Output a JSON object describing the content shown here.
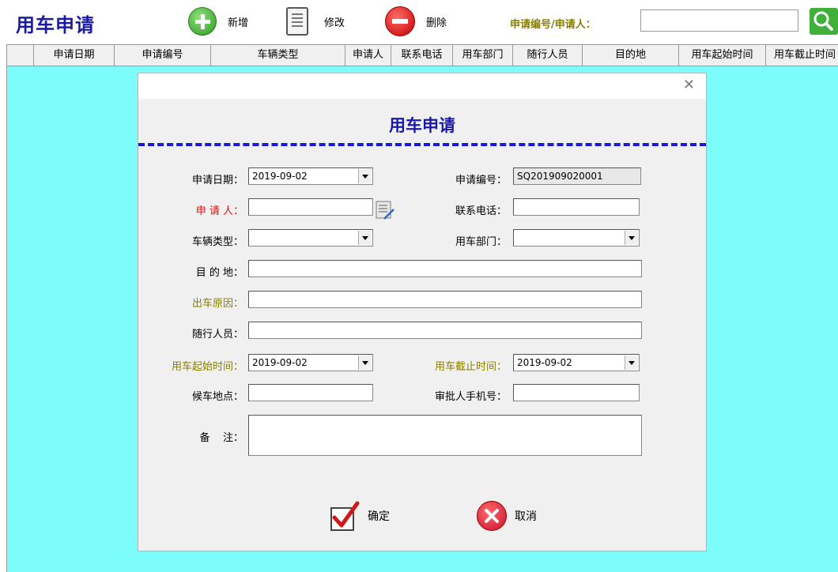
{
  "app": {
    "title": "用车申请"
  },
  "toolbar": {
    "add_label": "新增",
    "edit_label": "修改",
    "delete_label": "删除",
    "search_label": "申请编号/申请人：",
    "search_value": ""
  },
  "grid": {
    "columns": [
      "申请日期",
      "申请编号",
      "车辆类型",
      "申请人",
      "联系电话",
      "用车部门",
      "随行人员",
      "目的地",
      "用车起始时间",
      "用车截止时间"
    ]
  },
  "dialog": {
    "heading": "用车申请",
    "fields": {
      "apply_date": {
        "label": "申请日期：",
        "value": "2019-09-02"
      },
      "apply_no": {
        "label": "申请编号：",
        "value": "SQ201909020001"
      },
      "applicant": {
        "label": "申 请 人：",
        "value": ""
      },
      "phone": {
        "label": "联系电话：",
        "value": ""
      },
      "vehicle_type": {
        "label": "车辆类型：",
        "value": ""
      },
      "department": {
        "label": "用车部门：",
        "value": ""
      },
      "destination": {
        "label": "目 的 地：",
        "value": ""
      },
      "reason": {
        "label": "出车原因：",
        "value": ""
      },
      "companions": {
        "label": "随行人员：",
        "value": ""
      },
      "start_time": {
        "label": "用车起始时间：",
        "value": "2019-09-02"
      },
      "end_time": {
        "label": "用车截止时间：",
        "value": "2019-09-02"
      },
      "waiting_place": {
        "label": "候车地点：",
        "value": ""
      },
      "approver_phone": {
        "label": "审批人手机号：",
        "value": ""
      },
      "remarks": {
        "label": "备    注：",
        "value": ""
      }
    },
    "ok_label": "确定",
    "cancel_label": "取消"
  },
  "colors": {
    "title_blue": "#1a1aa8",
    "grid_background": "#7dfcfc",
    "required_red": "#e01010",
    "olive_label": "#8a7f00"
  },
  "icons": [
    "add-icon",
    "edit-document-icon",
    "delete-icon",
    "search-icon",
    "pick-user-icon",
    "close-icon",
    "checkmark-icon",
    "cancel-icon"
  ]
}
